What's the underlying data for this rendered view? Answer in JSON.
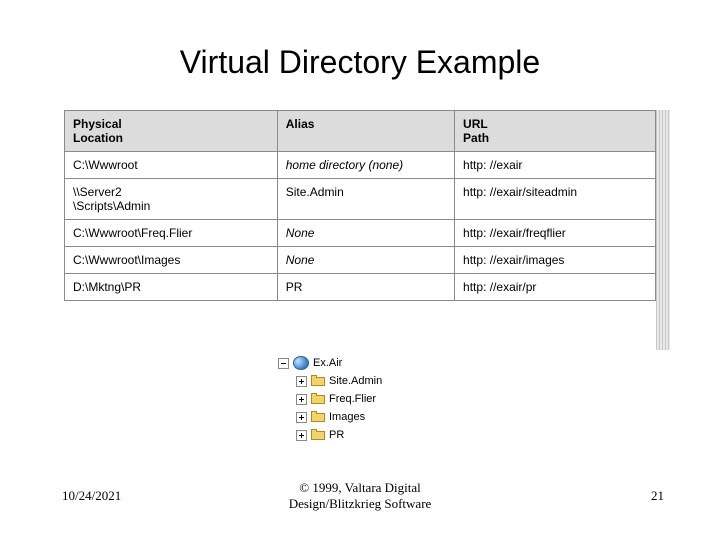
{
  "title": "Virtual Directory Example",
  "columns": {
    "c0": "Physical\nLocation",
    "c1": "Alias",
    "c2": "URL\nPath"
  },
  "rows": [
    {
      "phys": "C:\\Wwwroot",
      "alias": "home directory (none)",
      "alias_i": true,
      "url": "http: //exair"
    },
    {
      "phys": "\\\\Server2\n\\Scripts\\Admin",
      "alias": "Site.Admin",
      "alias_i": false,
      "url": "http: //exair/siteadmin"
    },
    {
      "phys": "C:\\Wwwroot\\Freq.Flier",
      "alias": "None",
      "alias_i": true,
      "url": "http: //exair/freqflier"
    },
    {
      "phys": "C:\\Wwwroot\\Images",
      "alias": "None",
      "alias_i": true,
      "url": "http: //exair/images"
    },
    {
      "phys": "D:\\Mktng\\PR",
      "alias": "PR",
      "alias_i": false,
      "url": "http: //exair/pr"
    }
  ],
  "tree": {
    "root": "Ex.Air",
    "children": [
      "Site.Admin",
      "Freq.Flier",
      "Images",
      "PR"
    ]
  },
  "footer": {
    "date": "10/24/2021",
    "copyright": "© 1999, Valtara Digital\nDesign/Blitzkrieg Software",
    "page": "21"
  }
}
